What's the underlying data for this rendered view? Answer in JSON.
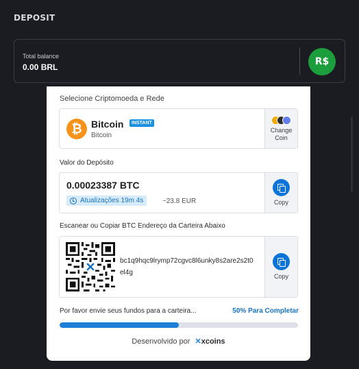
{
  "header": {
    "title": "DEPOSIT"
  },
  "balance": {
    "label": "Total balance",
    "value": "0.00 BRL",
    "currency_symbol": "R$"
  },
  "panel": {
    "cut_label": "Selecione Criptomoeda e Rede",
    "crypto": {
      "name": "Bitcoin",
      "badge": "INSTANT",
      "network": "Bitcoin",
      "icon": "bitcoin-icon",
      "change_label_1": "Change",
      "change_label_2": "Coin"
    },
    "amount": {
      "label": "Valor do Depósito",
      "value": "0.00023387 BTC",
      "timer": "Atualizações 19m 4s",
      "eur": "~23.8 EUR",
      "copy_label": "Copy"
    },
    "address": {
      "label": "Escanear ou Copiar BTC Endereço da Carteira Abaixo",
      "value": "bc1q9hqc9lrymp72cgvc8l6unky8s2are2s2t0el4g",
      "copy_label": "Copy"
    },
    "progress": {
      "message": "Por favor envie seus fundos para a carteira...",
      "percent_label": "50% Para Completar",
      "fraction": 0.5
    },
    "footer": {
      "prefix": "Desenvolvido por",
      "brand": "xcoins"
    }
  },
  "colors": {
    "accent": "#1f7fd6",
    "badge_green": "#1d9e3c",
    "bitcoin_orange": "#f7931a"
  }
}
